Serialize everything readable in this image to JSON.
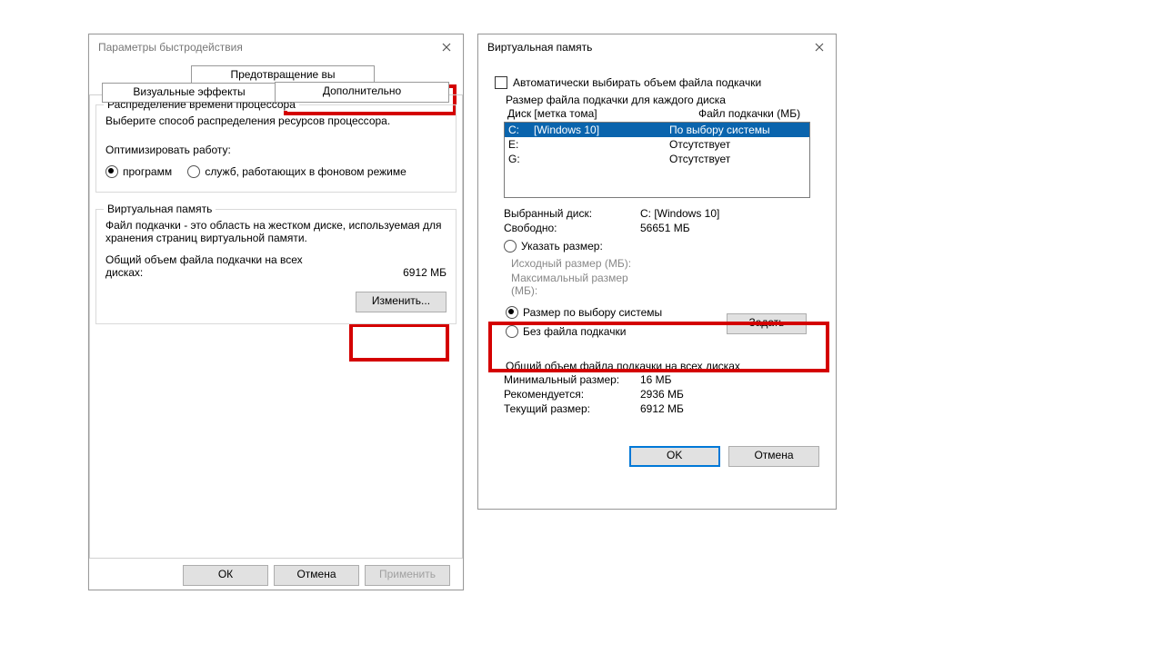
{
  "perf": {
    "title": "Параметры быстродействия",
    "tab_dep": "Предотвращение вы",
    "tab_vfx": "Визуальные эффекты",
    "tab_adv": "Дополнительно",
    "sched": {
      "title": "Распределение времени процессора",
      "desc": "Выберите способ распределения ресурсов процессора.",
      "opt_label": "Оптимизировать работу:",
      "opt1": "программ",
      "opt2": "служб, работающих в фоновом режиме"
    },
    "vm": {
      "title": "Виртуальная память",
      "desc": "Файл подкачки - это область на жестком диске, используемая для хранения страниц виртуальной памяти.",
      "total_label": "Общий объем файла подкачки на всех дисках:",
      "total_value": "6912 МБ",
      "change": "Изменить..."
    },
    "ok": "ОК",
    "cancel": "Отмена",
    "apply": "Применить"
  },
  "vmd": {
    "title": "Виртуальная память",
    "auto": "Автоматически выбирать объем файла подкачки",
    "each_title": "Размер файла подкачки для каждого диска",
    "hdr_disk": "Диск [метка тома]",
    "hdr_file": "Файл подкачки (МБ)",
    "rows": [
      {
        "d": "C:",
        "l": "[Windows 10]",
        "v": "По выбору системы"
      },
      {
        "d": "E:",
        "l": "",
        "v": "Отсутствует"
      },
      {
        "d": "G:",
        "l": "",
        "v": "Отсутствует"
      }
    ],
    "sel_label": "Выбранный диск:",
    "sel_value": "C: [Windows 10]",
    "free_label": "Свободно:",
    "free_value": "56651 МБ",
    "custom": "Указать размер:",
    "ini_label": "Исходный размер (МБ):",
    "max_label": "Максимальный размер (МБ):",
    "sys": "Размер по выбору системы",
    "none": "Без файла подкачки",
    "set": "Задать",
    "total_title": "Общий объем файла подкачки на всех дисках",
    "min_l": "Минимальный размер:",
    "min_v": "16 МБ",
    "rec_l": "Рекомендуется:",
    "rec_v": "2936 МБ",
    "cur_l": "Текущий размер:",
    "cur_v": "6912 МБ",
    "ok": "OK",
    "cancel": "Отмена"
  }
}
